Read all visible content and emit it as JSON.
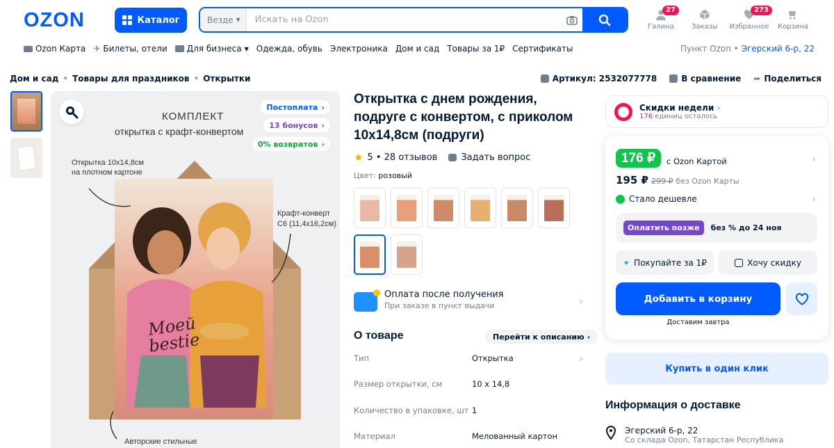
{
  "header": {
    "logo": "OZON",
    "catalog_label": "Каталог",
    "search_scope": "Везде",
    "search_placeholder": "Искать на Ozon",
    "icons": [
      {
        "label": "Галина",
        "badge": "27",
        "icon": "user-icon"
      },
      {
        "label": "Заказы",
        "badge": "",
        "icon": "box-icon"
      },
      {
        "label": "Избранное",
        "badge": "273",
        "icon": "heart-icon"
      },
      {
        "label": "Корзина",
        "badge": "",
        "icon": "cart-icon"
      }
    ]
  },
  "nav": {
    "items": [
      "Ozon Карта",
      "Билеты, отели",
      "Для бизнеса",
      "Одежда, обувь",
      "Электроника",
      "Дом и сад",
      "Товары за 1₽",
      "Сертификаты"
    ],
    "pickup_label": "Пункт Ozon •",
    "pickup_address": "Эгерский 6-р, 22"
  },
  "breadcrumbs": [
    "Дом и сад",
    "Товары для праздников",
    "Открытки"
  ],
  "actions": {
    "article": "Артикул: 2532077778",
    "compare": "В сравнение",
    "share": "Поделиться"
  },
  "image": {
    "chips": [
      "Постоплата",
      "13 бонусов",
      "0% возвратов"
    ],
    "title1": "КОМПЛЕКТ",
    "title2": "открытка с крафт-конвертом",
    "callout_card1": "Открытка 10х14,8см",
    "callout_card2": "на плотном картоне",
    "callout_env1": "Крафт-конверт",
    "callout_env2": "С6 (11,4х16,2см)",
    "callout_bottom": "Авторские стильные",
    "card_text": "Моей bestie"
  },
  "product": {
    "title": "Открытка с днем рождения, подруге с конвертом, с приколом 10х14,8см (подруги)",
    "rating": "5 • 28 отзывов",
    "ask": "Задать вопрос",
    "color_label": "Цвет:",
    "color_value": "розовый",
    "swatch_colors": [
      "#e8b9a4",
      "#e9a07a",
      "#cf8a6a",
      "#e6b070",
      "#c98a66",
      "#b87058",
      "#d98f6a",
      "#d4a58a"
    ],
    "pay_title": "Оплата после получения",
    "pay_sub": "При заказе в пункт выдачи",
    "about_title": "О товаре",
    "about_link": "Перейти к описанию",
    "specs": [
      {
        "k": "Тип",
        "v": "Открытка"
      },
      {
        "k": "Размер открытки, см",
        "v": "10 x 14,8"
      },
      {
        "k": "Количество в упаковке, шт",
        "v": "1"
      },
      {
        "k": "Материал",
        "v": "Мелованный картон"
      }
    ]
  },
  "buybox": {
    "weekly_title": "Скидки недели",
    "weekly_count": "176",
    "weekly_suffix": "единиц осталось",
    "price_card": "176 ₽",
    "price_card_note": "с Ozon Картой",
    "price": "195 ₽",
    "price_old": "299 ₽",
    "price_note": "без Ozon Карты",
    "cheaper": "Стало дешевле",
    "pay_later_btn": "Оплатить позже",
    "pay_later_text": "без % до 24 ноя",
    "buy_for_1": "Покупайте за 1₽",
    "want_discount": "Хочу скидку",
    "add_to_cart": "Добавить в корзину",
    "delivery_note": "Доставим завтра",
    "one_click": "Купить в один клик"
  },
  "delivery": {
    "title": "Информация о доставке",
    "address": "Эгерский 6-р, 22",
    "from": "Со склада Ozon, Татарстан Республика"
  },
  "colors": {
    "brand": "#005bff",
    "accent_pink": "#f91155",
    "green": "#10c44c",
    "purple": "#7546d2"
  }
}
